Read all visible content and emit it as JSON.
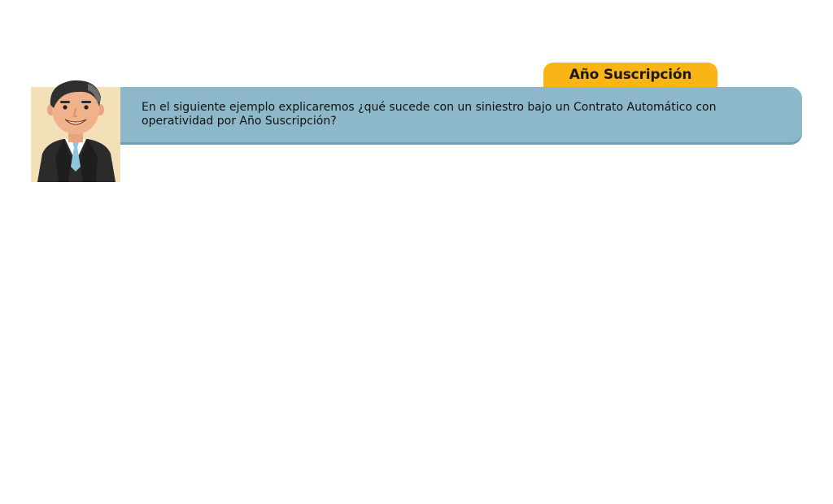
{
  "header": {
    "tab_label": "Año Suscripción"
  },
  "message": {
    "text": "En el siguiente ejemplo explicaremos ¿qué sucede con un siniestro bajo un Contrato Automático con operatividad por Año Suscripción?"
  },
  "avatar": {
    "icon": "businessman-avatar-icon"
  },
  "colors": {
    "tab": "#fbb415",
    "bubble": "#8db8c9",
    "avatar_bg": "#f3dfb8",
    "suit": "#2b2b2b",
    "tie": "#8ec6e0"
  }
}
